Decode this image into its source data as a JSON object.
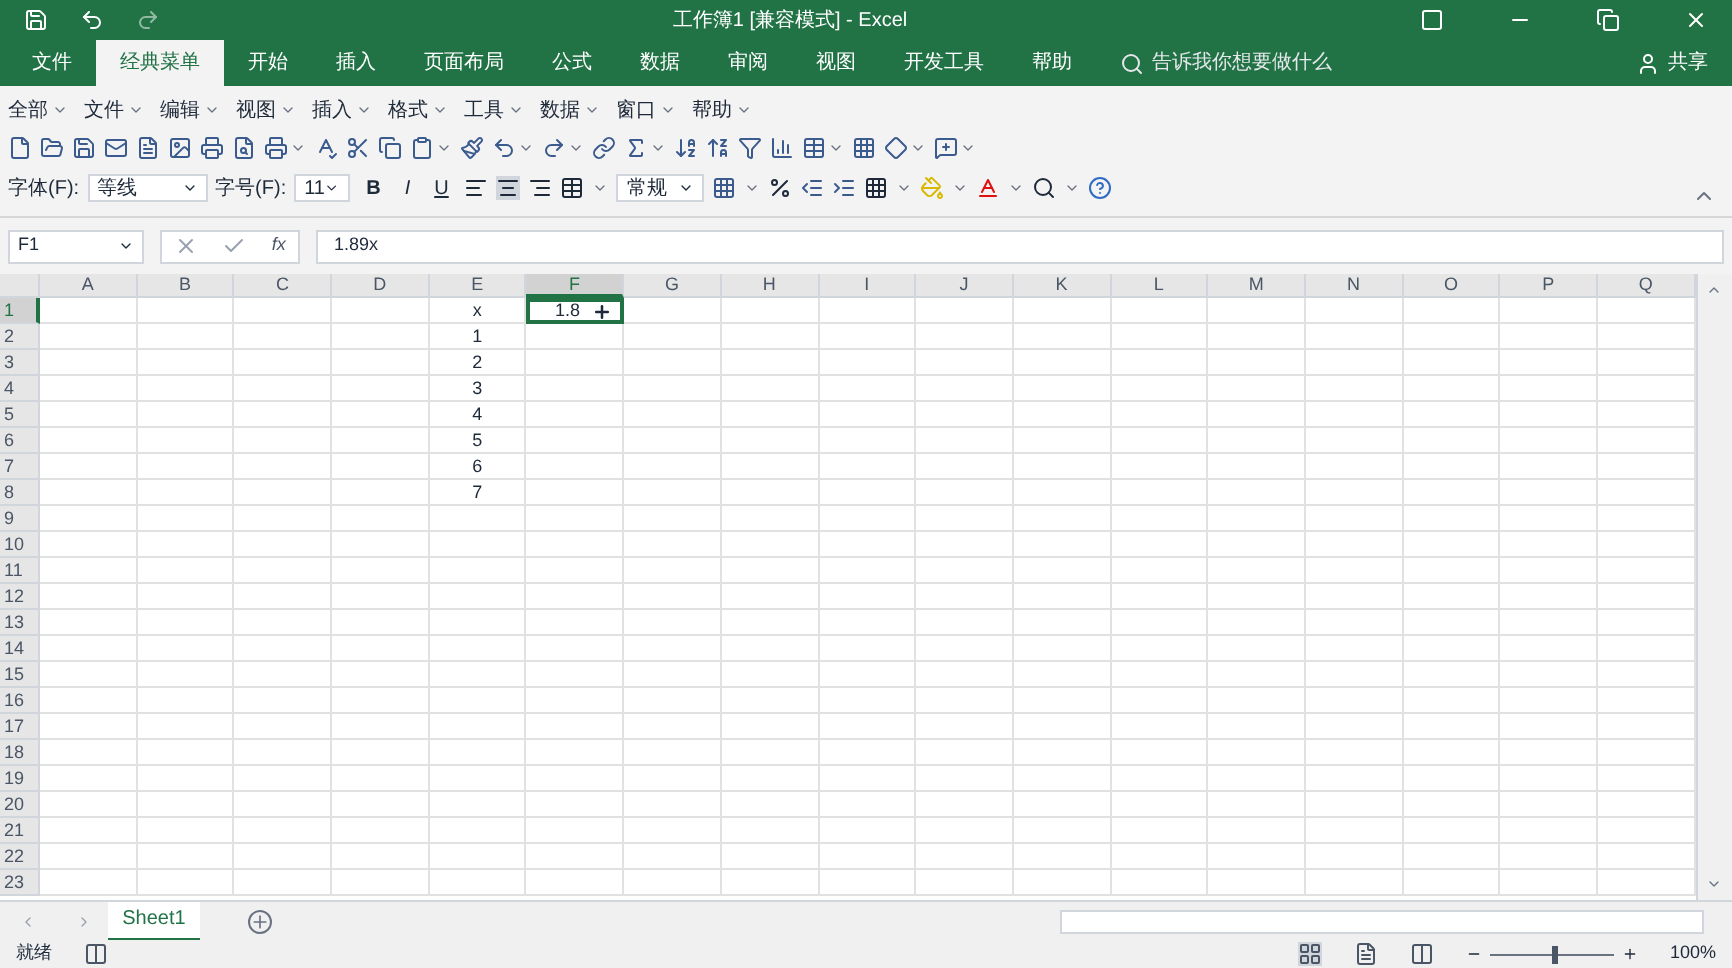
{
  "window": {
    "title": "工作簿1 [兼容模式] - Excel"
  },
  "ribbon_tabs": [
    {
      "label": "文件",
      "selected": false
    },
    {
      "label": "经典菜单",
      "selected": true
    },
    {
      "label": "开始",
      "selected": false
    },
    {
      "label": "插入",
      "selected": false
    },
    {
      "label": "页面布局",
      "selected": false
    },
    {
      "label": "公式",
      "selected": false
    },
    {
      "label": "数据",
      "selected": false
    },
    {
      "label": "审阅",
      "selected": false
    },
    {
      "label": "视图",
      "selected": false
    },
    {
      "label": "开发工具",
      "selected": false
    },
    {
      "label": "帮助",
      "selected": false
    }
  ],
  "tell_me": {
    "placeholder": "告诉我你想要做什么"
  },
  "share": "共享",
  "menus": [
    "全部",
    "文件",
    "编辑",
    "视图",
    "插入",
    "格式",
    "工具",
    "数据",
    "窗口",
    "帮助"
  ],
  "font_label": "字体(F):",
  "font": "等线",
  "size_label": "字号(F):",
  "size": "11",
  "number_format": "常规",
  "bold": "B",
  "italic": "I",
  "underline": "U",
  "name_box": "F1",
  "function_label": "fx",
  "formula": "1.89x",
  "columns": [
    {
      "label": "A",
      "selected": false
    },
    {
      "label": "B",
      "selected": false
    },
    {
      "label": "C",
      "selected": false
    },
    {
      "label": "D",
      "selected": false
    },
    {
      "label": "E",
      "selected": false,
      "values": [
        "x",
        "1",
        "2",
        "3",
        "4",
        "5",
        "6",
        "7"
      ]
    },
    {
      "label": "F",
      "selected": true,
      "values": [
        "1.8"
      ]
    },
    {
      "label": "G",
      "selected": false
    },
    {
      "label": "H",
      "selected": false
    },
    {
      "label": "I",
      "selected": false
    },
    {
      "label": "J",
      "selected": false
    },
    {
      "label": "K",
      "selected": false
    },
    {
      "label": "L",
      "selected": false
    },
    {
      "label": "M",
      "selected": false
    },
    {
      "label": "N",
      "selected": false
    },
    {
      "label": "O",
      "selected": false
    },
    {
      "label": "P",
      "selected": false
    },
    {
      "label": "Q",
      "selected": false
    }
  ],
  "rows": [
    {
      "label": "1",
      "selected": true
    },
    {
      "label": "2",
      "selected": false
    },
    {
      "label": "3",
      "selected": false
    },
    {
      "label": "4",
      "selected": false
    },
    {
      "label": "5",
      "selected": false
    },
    {
      "label": "6",
      "selected": false
    },
    {
      "label": "7",
      "selected": false
    },
    {
      "label": "8",
      "selected": false
    },
    {
      "label": "9",
      "selected": false
    },
    {
      "label": "10",
      "selected": false
    },
    {
      "label": "11",
      "selected": false
    },
    {
      "label": "12",
      "selected": false
    },
    {
      "label": "13",
      "selected": false
    },
    {
      "label": "14",
      "selected": false
    },
    {
      "label": "15",
      "selected": false
    },
    {
      "label": "16",
      "selected": false
    },
    {
      "label": "17",
      "selected": false
    },
    {
      "label": "18",
      "selected": false
    },
    {
      "label": "19",
      "selected": false
    },
    {
      "label": "20",
      "selected": false
    },
    {
      "label": "21",
      "selected": false
    },
    {
      "label": "22",
      "selected": false
    },
    {
      "label": "23",
      "selected": false
    }
  ],
  "sheets": [
    {
      "label": "Sheet1",
      "selected": true
    }
  ],
  "status": "就绪",
  "zoom": {
    "level": 0.5,
    "reading": "100%"
  }
}
